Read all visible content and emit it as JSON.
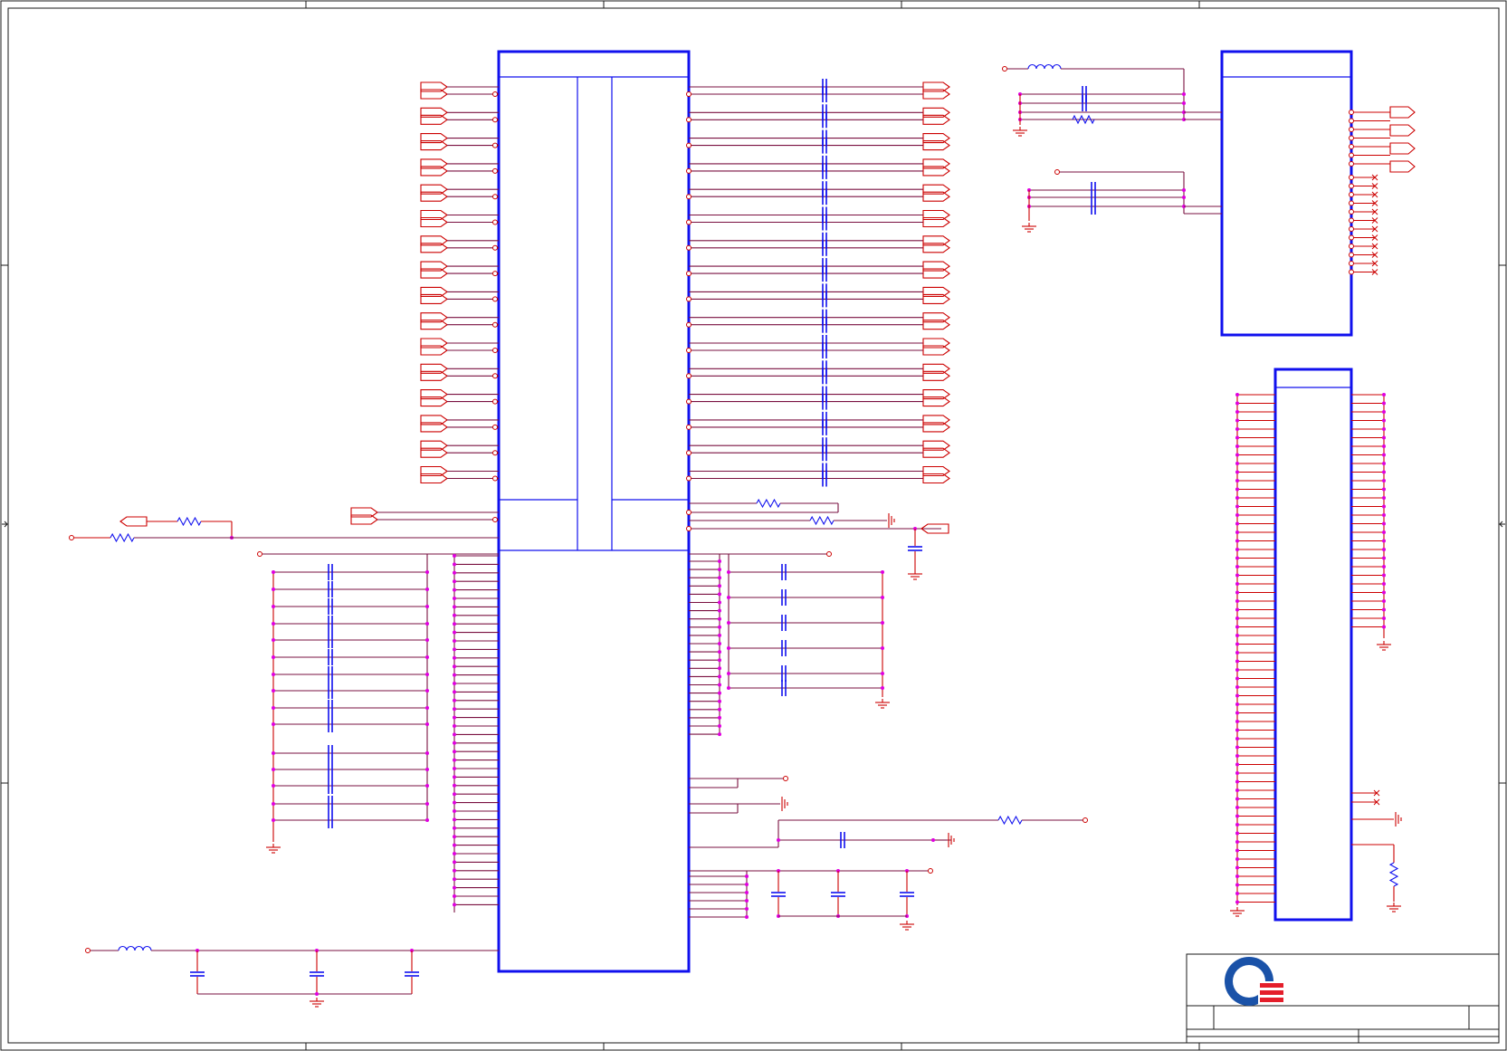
{
  "title_block": {
    "logo": "quanta-logo-icon",
    "logo_colors": {
      "ring": "#1a52a8",
      "bars": "#e41e2b"
    }
  },
  "colors": {
    "ic_outline": "#1010ee",
    "net_wire": "#cc0000",
    "bus_wire": "#7a1040",
    "junction": "#e000e0",
    "frame": "#1a1a1a"
  }
}
